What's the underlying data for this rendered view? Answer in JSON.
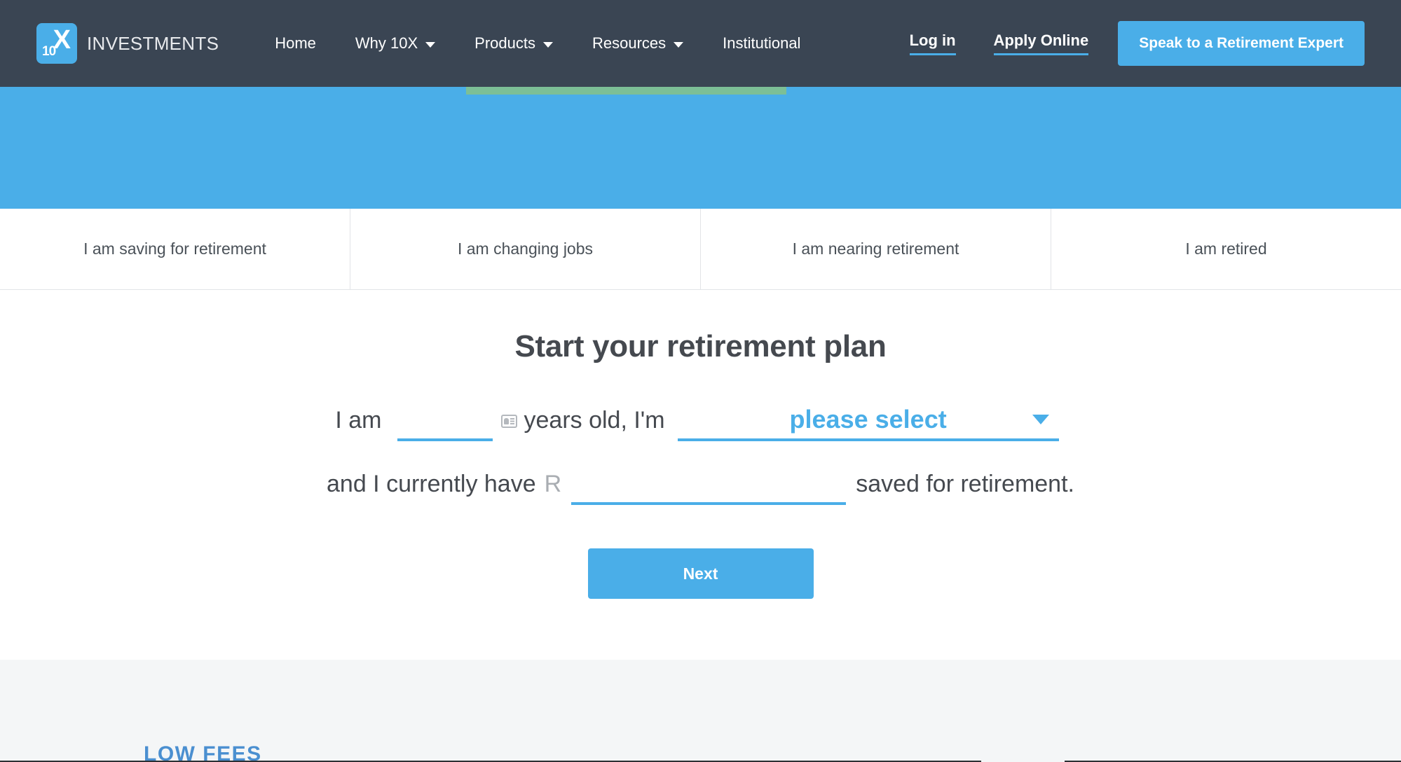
{
  "header": {
    "logo": {
      "mark_top": "X",
      "mark_bottom": "10",
      "brand_name": "INVESTMENTS"
    },
    "nav_items": [
      {
        "label": "Home",
        "has_dropdown": false
      },
      {
        "label": "Why 10X",
        "has_dropdown": true
      },
      {
        "label": "Products",
        "has_dropdown": true
      },
      {
        "label": "Resources",
        "has_dropdown": true
      },
      {
        "label": "Institutional",
        "has_dropdown": false
      }
    ],
    "login_label": "Log in",
    "apply_label": "Apply Online",
    "cta_label": "Speak to a Retirement Expert",
    "bg_color": "#3a4553",
    "accent_color": "#4aaee8"
  },
  "hero": {
    "bg_color": "#4aaee8",
    "green_bar_color": "#7cbf96"
  },
  "tabs": [
    {
      "label": "I am saving for retirement"
    },
    {
      "label": "I am changing jobs"
    },
    {
      "label": "I am nearing retirement"
    },
    {
      "label": "I am retired"
    }
  ],
  "form": {
    "title": "Start your retirement plan",
    "line1_prefix": "I am",
    "age_value": "",
    "age_placeholder": "",
    "line1_middle": "years old, I'm",
    "select_value": "please select",
    "line2_prefix": "and I currently have",
    "currency_symbol": "R",
    "amount_value": "",
    "amount_placeholder": "",
    "line2_suffix": "saved for retirement.",
    "next_label": "Next"
  },
  "footer": {
    "low_fees_label": "LOW FEES"
  }
}
